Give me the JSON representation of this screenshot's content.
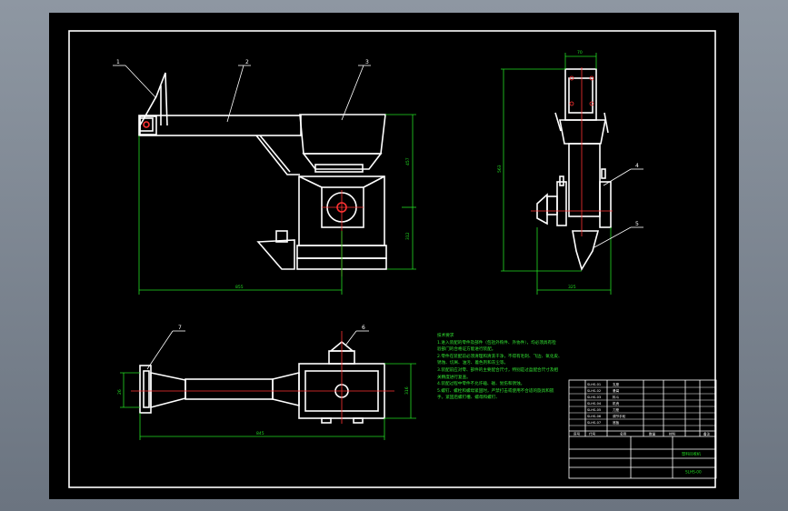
{
  "drawing": {
    "balloons": [
      "1",
      "2",
      "3",
      "4",
      "5",
      "6",
      "7"
    ],
    "dimensions": {
      "front_width": "855",
      "front_height_upper": "457",
      "front_height_lower": "312",
      "side_top_width": "70",
      "side_height": "563",
      "side_bottom_width": "325",
      "plan_left_height": "26",
      "plan_width": "845",
      "plan_right_height": "316"
    },
    "notes": {
      "title": "技术要求",
      "lines": [
        "1.进入装配的零件及部件（包括外购件、外协件），均必须具有检",
        "验部门的合格证方能进行装配。",
        "2.零件在装配前必须清理和清洗干净，不得有毛刺、飞边、氧化皮、",
        "锈蚀、切屑、油污、着色剂和灰尘等。",
        "3.装配前应对零、部件的主要配合尺寸，特别是过盈配合尺寸及相",
        "关精度进行复查。",
        "4.装配过程中零件不允许磕、碰、划伤和锈蚀。",
        "5.螺钉、螺栓和螺母紧固时，严禁打击或使用不合适的旋具和扳",
        "手。紧固后螺钉槽、螺母和螺钉、"
      ]
    },
    "title_block": {
      "header_no": "序号",
      "header_code": "代号",
      "header_name": "名称",
      "header_qty": "数量",
      "header_material": "材料",
      "header_remark": "备注",
      "drawing_name": "塑料回收机",
      "drawing_code": "SLHS-00",
      "parts": [
        {
          "code": "SLHS-01",
          "name": "支座"
        },
        {
          "code": "SLHS-02",
          "name": "悬臂"
        },
        {
          "code": "SLHS-03",
          "name": "料斗"
        },
        {
          "code": "SLHS-04",
          "name": "机壳"
        },
        {
          "code": "SLHS-05",
          "name": "刀座"
        },
        {
          "code": "SLHS-06",
          "name": "调节手轮"
        },
        {
          "code": "SLHS-07",
          "name": "底板"
        }
      ]
    }
  },
  "colors": {
    "outline": "#ffffff",
    "dimension": "#22dd22",
    "leader": "#ffffff",
    "center": "#ff3333",
    "background": "#000000"
  }
}
